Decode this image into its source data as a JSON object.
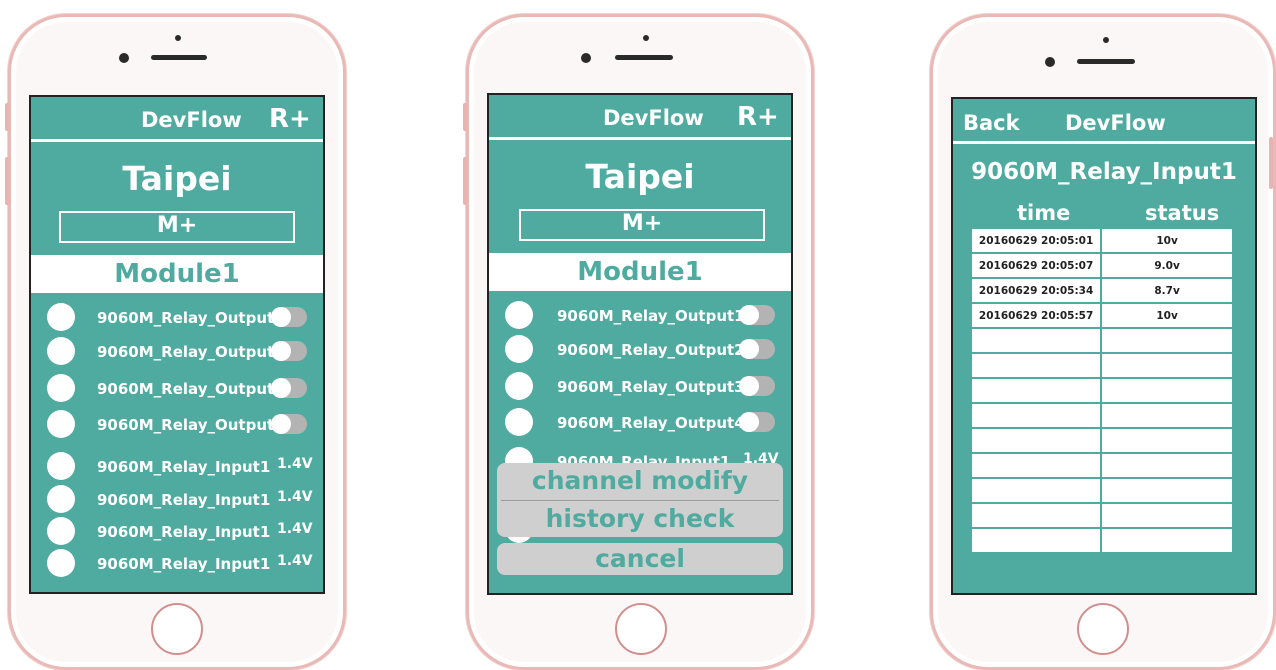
{
  "app": {
    "title": "DevFlow",
    "r_plus": "R+",
    "city": "Taipei",
    "m_plus": "M+",
    "module": "Module1"
  },
  "channels": [
    {
      "name": "9060M_Relay_Output1",
      "kind": "toggle"
    },
    {
      "name": "9060M_Relay_Output2",
      "kind": "toggle"
    },
    {
      "name": "9060M_Relay_Output3",
      "kind": "toggle"
    },
    {
      "name": "9060M_Relay_Output4",
      "kind": "toggle"
    },
    {
      "name": "9060M_Relay_Input1",
      "kind": "value",
      "value": "1.4V"
    },
    {
      "name": "9060M_Relay_Input1",
      "kind": "value",
      "value": "1.4V"
    },
    {
      "name": "9060M_Relay_Input1",
      "kind": "value",
      "value": "1.4V"
    },
    {
      "name": "9060M_Relay_Input1",
      "kind": "value",
      "value": "1.4V"
    }
  ],
  "action_sheet": {
    "channel_modify": "channel modify",
    "history_check": "history check",
    "cancel": "cancel"
  },
  "history": {
    "back": "Back",
    "title": "DevFlow",
    "channel": "9060M_Relay_Input1",
    "col_time": "time",
    "col_status": "status",
    "rows": [
      {
        "time": "20160629 20:05:01",
        "status": "10v"
      },
      {
        "time": "20160629 20:05:07",
        "status": "9.0v"
      },
      {
        "time": "20160629 20:05:34",
        "status": "8.7v"
      },
      {
        "time": "20160629 20:05:57",
        "status": "10v"
      },
      {
        "time": "",
        "status": ""
      },
      {
        "time": "",
        "status": ""
      },
      {
        "time": "",
        "status": ""
      },
      {
        "time": "",
        "status": ""
      },
      {
        "time": "",
        "status": ""
      },
      {
        "time": "",
        "status": ""
      },
      {
        "time": "",
        "status": ""
      },
      {
        "time": "",
        "status": ""
      },
      {
        "time": "",
        "status": ""
      }
    ]
  },
  "colors": {
    "teal": "#4fab9f",
    "phone_frame": "#e9b9b6",
    "sheet_gray": "#cfcfcf"
  }
}
